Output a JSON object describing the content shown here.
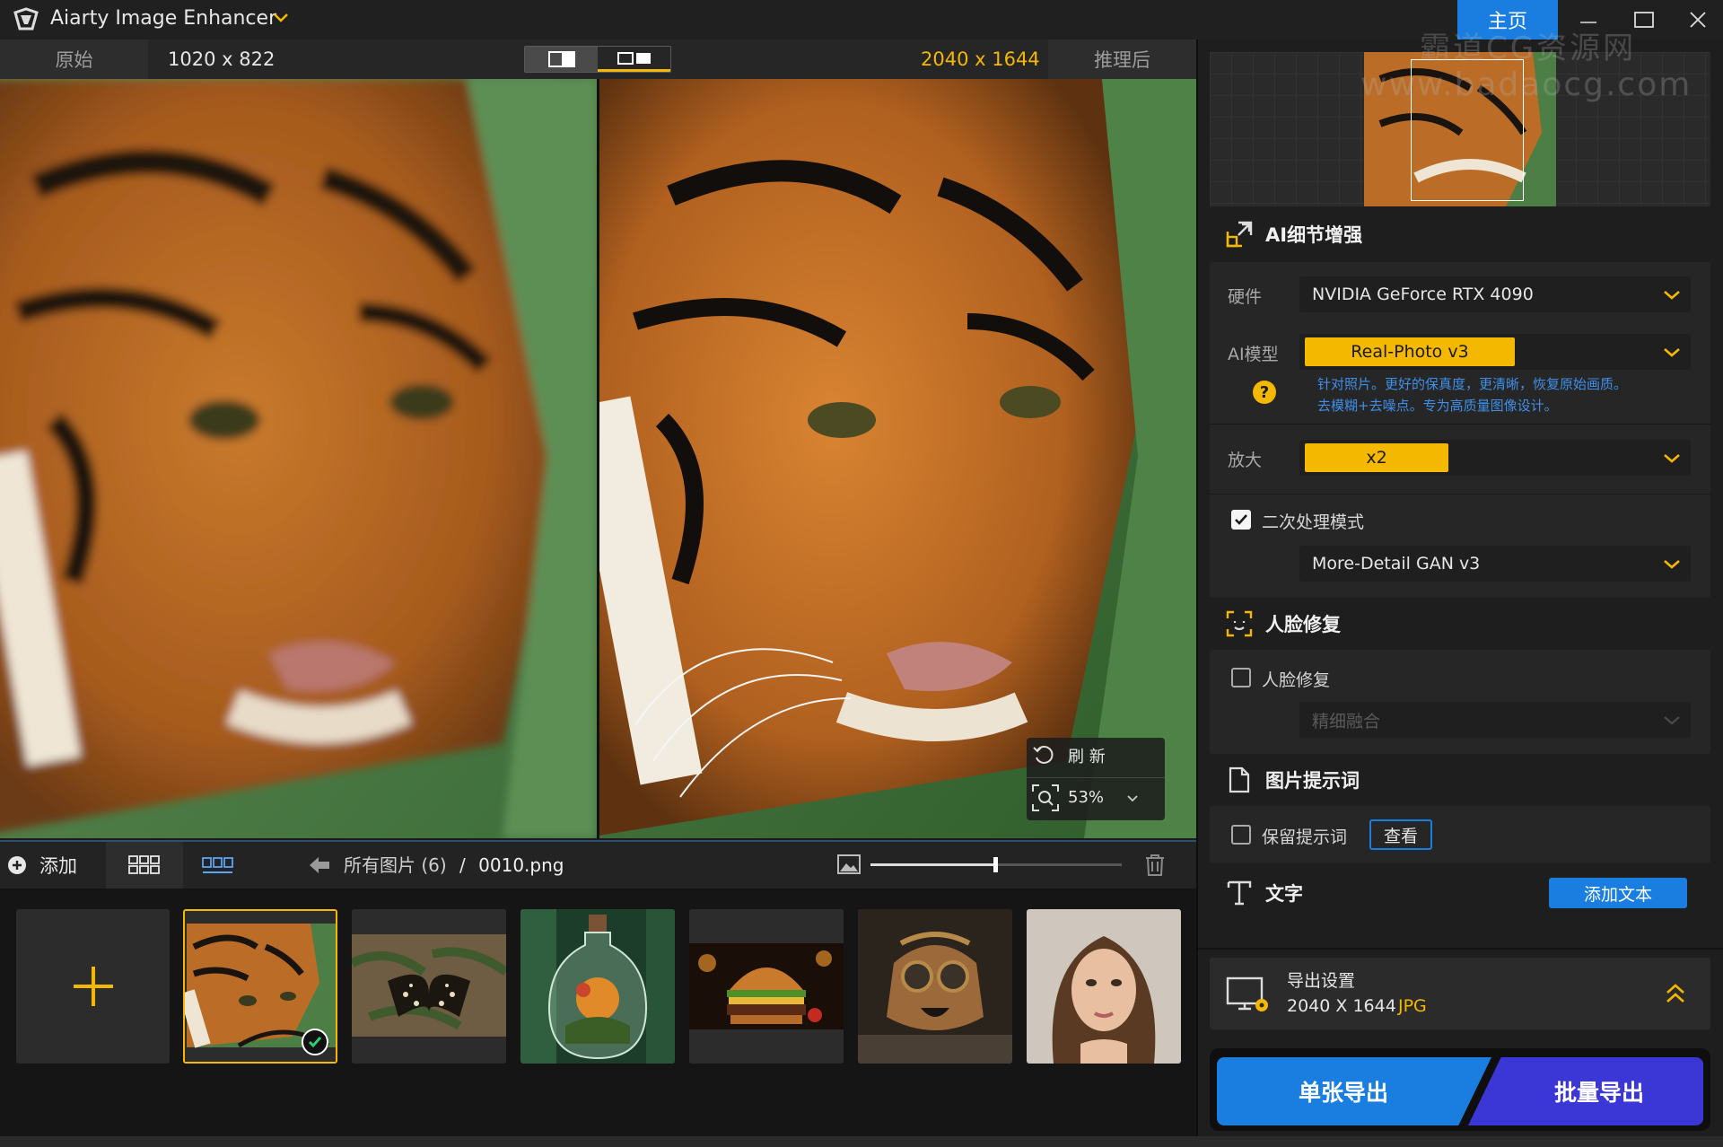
{
  "app": {
    "title": "Aiarty Image Enhancer",
    "home_tab": "主页"
  },
  "compare": {
    "original_label": "原始",
    "original_size": "1020 x 822",
    "result_size": "2040 x 1644",
    "result_label": "推理后"
  },
  "preview_tools": {
    "refresh_label": "刷 新",
    "zoom_value": "53%"
  },
  "bottom_toolbar": {
    "add_label": "添加",
    "breadcrumb_folder": "所有图片 (6)",
    "breadcrumb_sep": "/",
    "breadcrumb_file": "0010.png",
    "thumbnail_size_level": 0.5
  },
  "thumbnails": [
    {
      "name": "tiger",
      "selected": true
    },
    {
      "name": "butterfly",
      "selected": false
    },
    {
      "name": "bottle-terrarium",
      "selected": false
    },
    {
      "name": "burger",
      "selected": false
    },
    {
      "name": "steampunk-dog",
      "selected": false
    },
    {
      "name": "portrait-woman",
      "selected": false
    }
  ],
  "panel": {
    "ai_detail": {
      "title": "AI细节增强",
      "hardware_label": "硬件",
      "hardware_value": "NVIDIA GeForce RTX 4090",
      "model_label": "AI模型",
      "model_value": "Real-Photo  v3",
      "model_desc_line1": "针对照片。更好的保真度，更清晰，恢复原始画质。",
      "model_desc_line2": "去模糊+去噪点。专为高质量图像设计。",
      "upscale_label": "放大",
      "upscale_value": "x2",
      "second_pass_label": "二次处理模式",
      "second_pass_checked": true,
      "second_pass_model": "More-Detail GAN  v3"
    },
    "face": {
      "title": "人脸修复",
      "toggle_label": "人脸修复",
      "checked": false,
      "mode_placeholder": "精细融合"
    },
    "prompt": {
      "title": "图片提示词",
      "keep_label": "保留提示词",
      "checked": false,
      "view_button": "查看"
    },
    "text": {
      "title": "文字",
      "add_button": "添加文本"
    },
    "export": {
      "title": "导出设置",
      "size": "2040 X 1644",
      "format": "JPG",
      "single_button": "单张导出",
      "batch_button": "批量导出"
    },
    "watermark": {
      "line1": "霸道CG资源网",
      "line2": "www.badaocg.com"
    }
  },
  "colors": {
    "accent_yellow": "#f5b800",
    "accent_blue": "#1a7ee0",
    "batch_purple": "#3a37d6",
    "desc_blue": "#3f8fe8"
  }
}
